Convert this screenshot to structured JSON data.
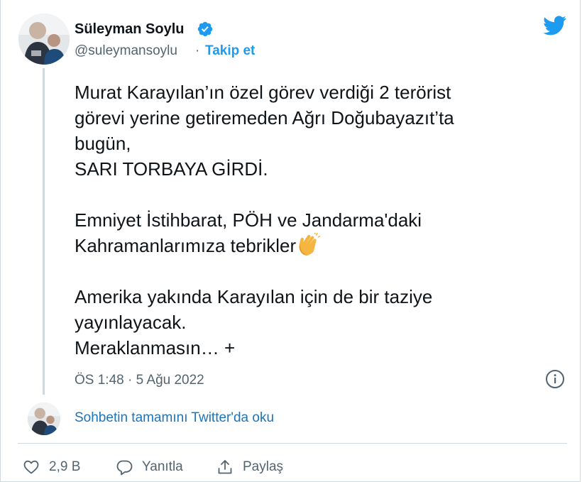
{
  "author": {
    "name": "Süleyman Soylu",
    "handle": "@suleymansoylu",
    "separator": "·",
    "follow_label": "Takip et"
  },
  "tweet": {
    "lines": [
      "Murat Karayılan’ın özel görev verdiği 2 terörist",
      "görevi yerine getiremeden Ağrı Doğubayazıt’ta",
      "bugün,",
      "SARI TORBAYA GİRDİ.",
      "",
      "Emniyet İstihbarat, PÖH ve Jandarma'daki",
      "Kahramanlarımıza tebrikler",
      "",
      "Amerika yakında Karayılan için de bir taziye",
      "yayınlayacak.",
      "Meraklanmasın… +"
    ],
    "emoji": "clapping-hands",
    "timestamp": "ÖS 1:48 · 5 Ağu 2022"
  },
  "read_more": "Sohbetin tamamını Twitter'da oku",
  "actions": {
    "like_count": "2,9 B",
    "reply_label": "Yanıtla",
    "share_label": "Paylaş"
  },
  "colors": {
    "accent": "#1d9bf0",
    "text": "#0f1419",
    "secondary": "#536471",
    "border": "#cfd9de"
  }
}
